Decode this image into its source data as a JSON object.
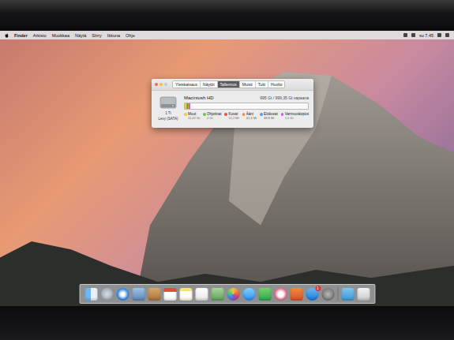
{
  "menu_bar": {
    "items": [
      {
        "label": "Finder",
        "bold": true
      },
      {
        "label": "Arkisto",
        "bold": false
      },
      {
        "label": "Muokkaa",
        "bold": false
      },
      {
        "label": "Näytä",
        "bold": false
      },
      {
        "label": "Siirry",
        "bold": false
      },
      {
        "label": "Ikkuna",
        "bold": false
      },
      {
        "label": "Ohje",
        "bold": false
      }
    ],
    "clock": "su 7.45"
  },
  "window": {
    "tabs": [
      {
        "label": "Yleiskatsaus",
        "selected": false
      },
      {
        "label": "Näytöt",
        "selected": false
      },
      {
        "label": "Tallennus",
        "selected": true
      },
      {
        "label": "Muisti",
        "selected": false
      },
      {
        "label": "Tuki",
        "selected": false
      },
      {
        "label": "Huolto",
        "selected": false
      }
    ],
    "disk": {
      "name": "Macintosh HD",
      "free": "995 Gt / 999,35 Gt vapaana",
      "capacity": "1 Tt",
      "type": "Levy (SATA)"
    },
    "categories": [
      {
        "name": "Muut",
        "size": "11,42 Gt",
        "color": "#f2c94c",
        "level": 0.011
      },
      {
        "name": "Ohjelmat",
        "size": "2 Gt",
        "color": "#72c84e",
        "level": 0.004
      },
      {
        "name": "Kuvat",
        "size": "51,2 Mt",
        "color": "#e0564c",
        "level": 0.002
      },
      {
        "name": "Ääni",
        "size": "41,3 Mt",
        "color": "#f08a3e",
        "level": 0.002
      },
      {
        "name": "Elokuvat",
        "size": "48,8 Mt",
        "color": "#5aa0e8",
        "level": 0.002
      },
      {
        "name": "Varmuuskopiot",
        "size": "1,5 Gt",
        "color": "#b36ad6",
        "level": 0.003
      }
    ]
  },
  "dock": {
    "badge": "1"
  }
}
